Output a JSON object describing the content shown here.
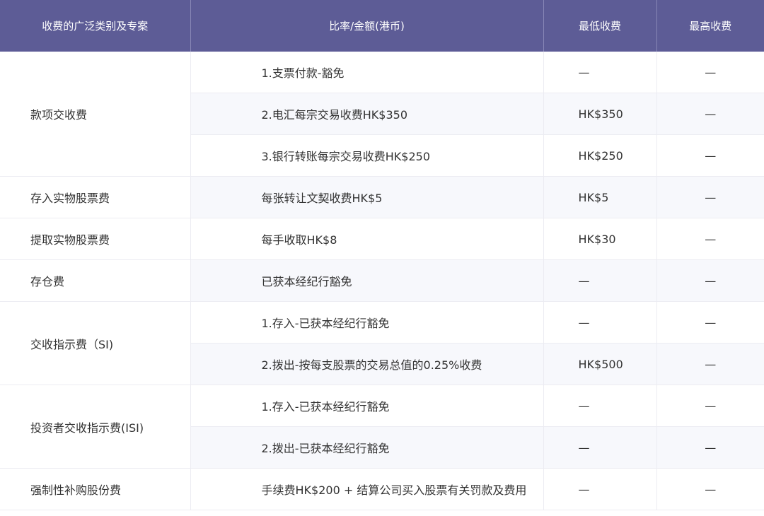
{
  "header": {
    "col_category": "收费的广泛类别及专案",
    "col_rate": "比率/金额(港币)",
    "col_min": "最低收费",
    "col_max": "最高收费"
  },
  "categories": {
    "cash": "款项交收费",
    "deposit_cert": "存入实物股票费",
    "withdraw_cert": "提取实物股票费",
    "custody": "存仓费",
    "si": "交收指示费（SI)",
    "isi": "投资者交收指示费(ISI)",
    "buyin": "强制性补购股份费"
  },
  "rows": [
    {
      "rate": "1.支票付款-豁免",
      "min": "—",
      "max": "—"
    },
    {
      "rate": "2.电汇每宗交易收费HK$350",
      "min": "HK$350",
      "max": "—"
    },
    {
      "rate": "3.银行转账每宗交易收费HK$250",
      "min": "HK$250",
      "max": "—"
    },
    {
      "rate": "每张转让文契收费HK$5",
      "min": "HK$5",
      "max": "—"
    },
    {
      "rate": "每手收取HK$8",
      "min": "HK$30",
      "max": "—"
    },
    {
      "rate": "已获本经纪行豁免",
      "min": "—",
      "max": "—"
    },
    {
      "rate": "1.存入-已获本经纪行豁免",
      "min": "—",
      "max": "—"
    },
    {
      "rate": "2.拨出-按每支股票的交易总值的0.25%收费",
      "min": "HK$500",
      "max": "—"
    },
    {
      "rate": "1.存入-已获本经纪行豁免",
      "min": "—",
      "max": "—"
    },
    {
      "rate": "2.拨出-已获本经纪行豁免",
      "min": "—",
      "max": "—"
    },
    {
      "rate": "手续费HK$200 + 结算公司买入股票有关罚款及费用",
      "min": "—",
      "max": "—"
    }
  ]
}
